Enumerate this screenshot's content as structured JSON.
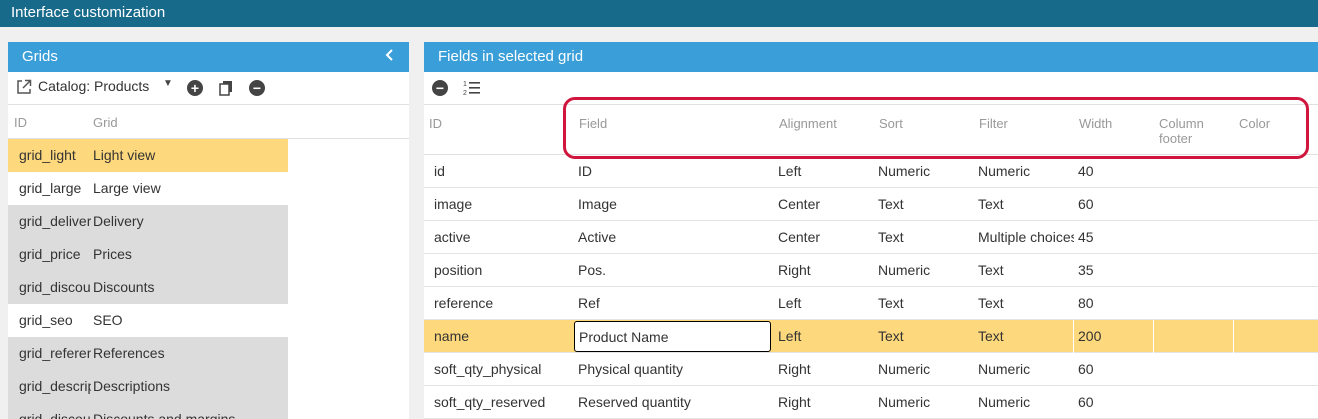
{
  "window": {
    "title": "Interface customization"
  },
  "grids_panel": {
    "title": "Grids",
    "collapse_icon": "chevron-left-icon",
    "selected_catalog": "Catalog: Products",
    "headers": {
      "id": "ID",
      "grid": "Grid"
    },
    "rows": [
      {
        "id": "grid_light",
        "grid": "Light view"
      },
      {
        "id": "grid_large",
        "grid": "Large view"
      },
      {
        "id": "grid_delivery",
        "grid": "Delivery"
      },
      {
        "id": "grid_price",
        "grid": "Prices"
      },
      {
        "id": "grid_discount",
        "grid": "Discounts"
      },
      {
        "id": "grid_seo",
        "grid": "SEO"
      },
      {
        "id": "grid_reference",
        "grid": "References"
      },
      {
        "id": "grid_description",
        "grid": "Descriptions"
      },
      {
        "id": "grid_discount_margin",
        "grid": "Discounts and margins"
      }
    ]
  },
  "fields_panel": {
    "title": "Fields in selected grid",
    "headers": {
      "id": "ID",
      "field": "Field",
      "alignment": "Alignment",
      "sort": "Sort",
      "filter": "Filter",
      "width": "Width",
      "column_footer": "Column footer",
      "color": "Color"
    },
    "rows": [
      {
        "id": "id",
        "field": "ID",
        "alignment": "Left",
        "sort": "Numeric",
        "filter": "Numeric",
        "width": "40"
      },
      {
        "id": "image",
        "field": "Image",
        "alignment": "Center",
        "sort": "Text",
        "filter": "Text",
        "width": "60"
      },
      {
        "id": "active",
        "field": "Active",
        "alignment": "Center",
        "sort": "Text",
        "filter": "Multiple choices",
        "width": "45"
      },
      {
        "id": "position",
        "field": "Pos.",
        "alignment": "Right",
        "sort": "Numeric",
        "filter": "Text",
        "width": "35"
      },
      {
        "id": "reference",
        "field": "Ref",
        "alignment": "Left",
        "sort": "Text",
        "filter": "Text",
        "width": "80"
      },
      {
        "id": "name",
        "field": "Product Name",
        "alignment": "Left",
        "sort": "Text",
        "filter": "Text",
        "width": "200"
      },
      {
        "id": "soft_qty_physical",
        "field": "Physical quantity",
        "alignment": "Right",
        "sort": "Numeric",
        "filter": "Numeric",
        "width": "60"
      },
      {
        "id": "soft_qty_reserved",
        "field": "Reserved quantity",
        "alignment": "Right",
        "sort": "Numeric",
        "filter": "Numeric",
        "width": "60"
      }
    ]
  },
  "colors": {
    "titlebar": "#186a8b",
    "panel_header": "#3a9fd8",
    "selected_row": "#fed87c",
    "annotation": "#d0163d"
  }
}
